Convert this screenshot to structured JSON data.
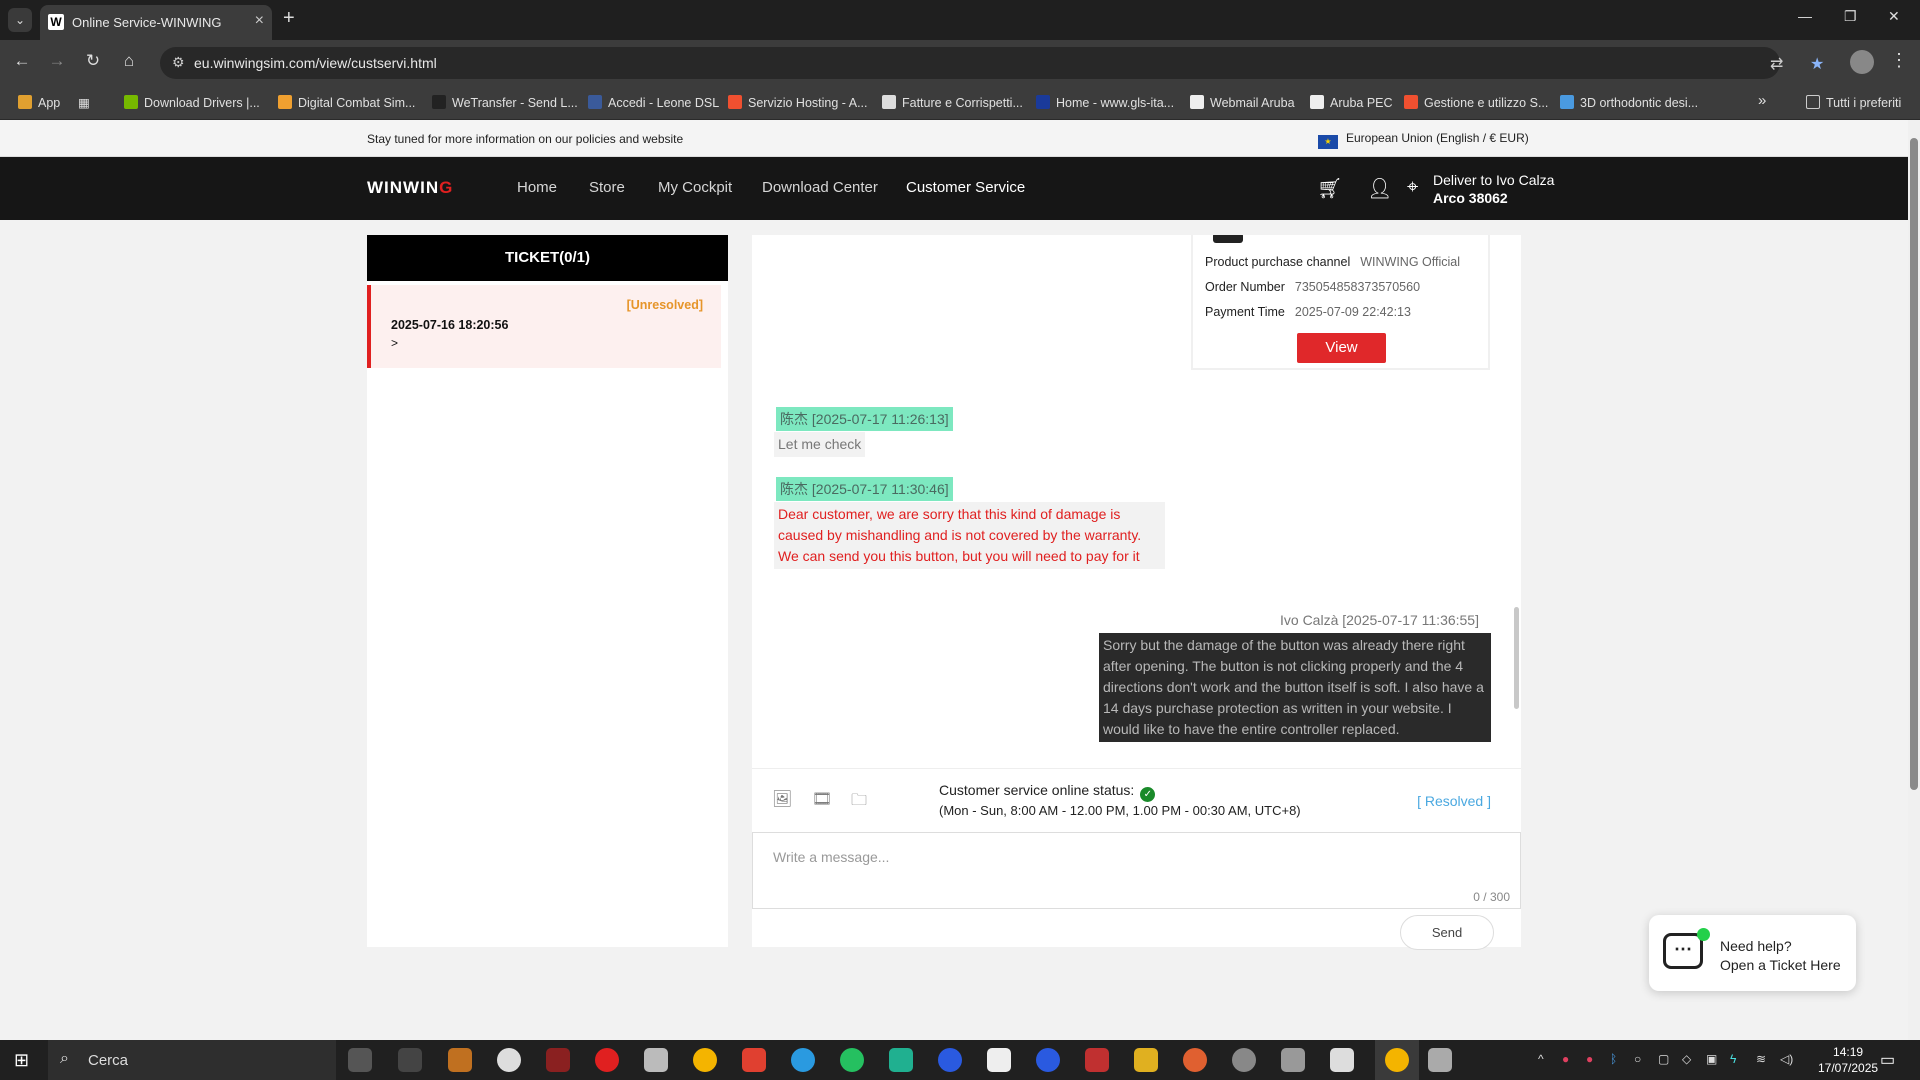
{
  "browser": {
    "tab_title": "Online Service-WINWING",
    "tab_favicon": "W",
    "url": "eu.winwingsim.com/view/custservi.html",
    "bookmarks": [
      {
        "label": "App",
        "color": "#e0a030"
      },
      {
        "label": "Download Drivers |...",
        "color": "#76b900"
      },
      {
        "label": "Digital Combat Sim...",
        "color": "#f0a030"
      },
      {
        "label": "WeTransfer - Send L...",
        "color": "#222222"
      },
      {
        "label": "Accedi - Leone DSL",
        "color": "#3a5a9a"
      },
      {
        "label": "Servizio Hosting - A...",
        "color": "#f05030"
      },
      {
        "label": "Fatture e Corrispetti...",
        "color": "#dddddd"
      },
      {
        "label": "Home - www.gls-ita...",
        "color": "#1a3a9a"
      },
      {
        "label": "Webmail Aruba",
        "color": "#eeeeee"
      },
      {
        "label": "Aruba PEC",
        "color": "#eeeeee"
      },
      {
        "label": "Gestione e utilizzo S...",
        "color": "#f05030"
      },
      {
        "label": "3D orthodontic desi...",
        "color": "#4a9ae0"
      }
    ],
    "bookmarks_more": "»",
    "all_bookmarks": "Tutti i preferiti"
  },
  "notice": {
    "text": "Stay tuned for more information on our policies and website",
    "region": "European Union (English / € EUR)"
  },
  "header": {
    "logo_main": "WINWIN",
    "logo_accent": "G",
    "nav": [
      "Home",
      "Store",
      "My Cockpit",
      "Download Center",
      "Customer Service"
    ],
    "deliver_line1": "Deliver to Ivo Calza",
    "deliver_line2": "Arco 38062"
  },
  "tickets": {
    "title": "TICKET(0/1)",
    "items": [
      {
        "status": "[Unresolved]",
        "date": "2025-07-16 18:20:56",
        "arrow": ">"
      }
    ]
  },
  "order": {
    "channel_label": "Product purchase channel",
    "channel_value": "WINWING Official",
    "order_label": "Order Number",
    "order_value": "735054858373570560",
    "payment_label": "Payment Time",
    "payment_value": "2025-07-09 22:42:13",
    "view_label": "View"
  },
  "messages": [
    {
      "meta": "陈杰 [2025-07-17 11:26:13]",
      "text": "Let me check"
    },
    {
      "meta": "陈杰 [2025-07-17 11:30:46]",
      "text": "Dear customer, we are sorry that this kind of damage is caused by mishandling and is not covered by the warranty. We can send you this button, but you will need to pay for it"
    },
    {
      "meta": "Ivo Calzà [2025-07-17 11:36:55]",
      "text": "Sorry but the damage of the button was already there right after opening. The button is not clicking properly and the 4 directions don't work and the button itself is soft. I also have a 14 days purchase protection as written in your website. I would like to have the entire controller replaced."
    }
  ],
  "chat": {
    "online_label": "Customer service online status:",
    "hours": "(Mon - Sun, 8:00 AM - 12.00 PM, 1.00 PM - 00:30 AM, UTC+8)",
    "resolved": "[ Resolved ]",
    "placeholder": "Write a message...",
    "counter": "0 / 300",
    "send": "Send"
  },
  "help": {
    "line1": "Need help?",
    "line2": "Open a Ticket Here"
  },
  "taskbar": {
    "search": "Cerca",
    "time": "14:19",
    "date": "17/07/2025"
  }
}
